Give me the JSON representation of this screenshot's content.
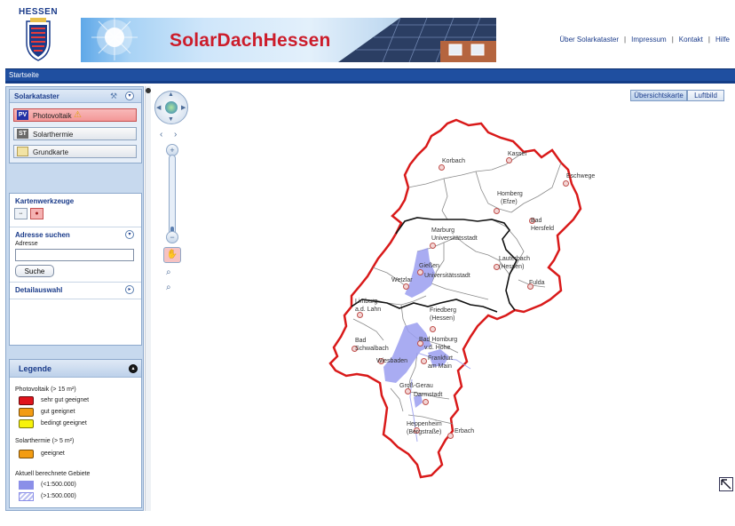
{
  "header": {
    "logo_text": "HESSEN",
    "banner_title": "SolarDachHessen",
    "links": [
      "Über Solarkataster",
      "Impressum",
      "Kontakt",
      "Hilfe"
    ]
  },
  "navbar": {
    "label": "Startseite"
  },
  "solarkataster": {
    "title": "Solarkataster",
    "layers": [
      {
        "icon": "PV",
        "label": "Photovoltaik",
        "active": true
      },
      {
        "icon": "ST",
        "label": "Solarthermie",
        "active": false
      },
      {
        "icon": "map-icon",
        "label": "Grundkarte",
        "active": false
      }
    ]
  },
  "tools": {
    "title": "Kartenwerkzeuge",
    "search_title": "Adresse suchen",
    "address_label": "Adresse",
    "address_value": "",
    "search_button": "Suche",
    "detail_title": "Detailauswahl"
  },
  "legend": {
    "title": "Legende",
    "pv_title": "Photovoltaik (> 15 m²)",
    "pv_items": [
      {
        "label": "sehr gut geeignet",
        "color": "#e0141c"
      },
      {
        "label": "gut geeignet",
        "color": "#f39c12"
      },
      {
        "label": "bedingt geeignet",
        "color": "#f7f20a"
      }
    ],
    "st_title": "Solarthermie (> 5 m²)",
    "st_items": [
      {
        "label": "geeignet",
        "color": "#f39c12"
      }
    ],
    "calc_title": "Aktuell berechnete Gebiete",
    "calc_items": [
      {
        "label": "(<1:500.000)",
        "color": "#8b8fe8"
      },
      {
        "label": "(>1:500.000)",
        "color": "#b9bdf0"
      }
    ]
  },
  "map": {
    "toggle_overview": "Übersichtskarte",
    "toggle_aerial": "Luftbild",
    "labels": [
      "Korbach",
      "Kassel",
      "Eschwege",
      "Homberg",
      "(Efze)",
      "Bad",
      "Hersfeld",
      "Marburg",
      "Universitätsstadt",
      "Lauterbach",
      "(Hessen)",
      "Gießen",
      "Universitätsstadt",
      "Wetzlar",
      "Fulda",
      "Limburg",
      "a.d. Lahn",
      "Friedberg",
      "(Hessen)",
      "Bad",
      "Schwalbach",
      "Bad Homburg",
      "v.d. Höhe",
      "Wiesbaden",
      "Frankfurt",
      "am Main",
      "Groß-Gerau",
      "Darmstadt",
      "Heppenheim",
      "(Bergstraße)",
      "Erbach"
    ]
  }
}
